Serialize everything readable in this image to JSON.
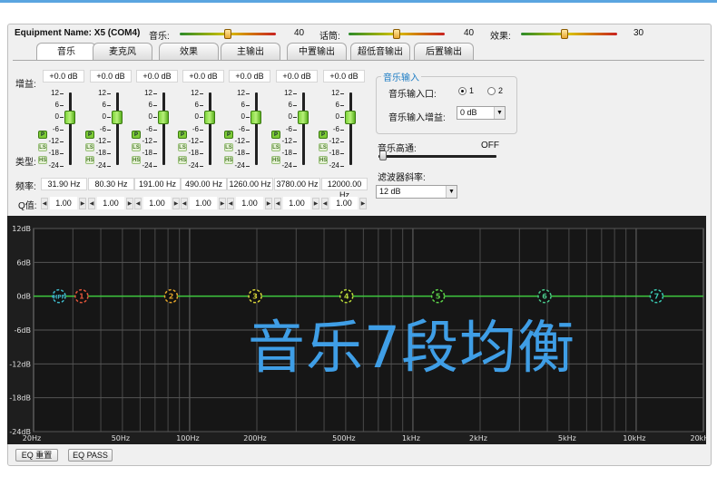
{
  "header": {
    "equipment_label": "Equipment Name: X5 (COM4)",
    "sliders": [
      {
        "label": "音乐:",
        "value": "40",
        "level": 0.5
      },
      {
        "label": "话筒:",
        "value": "40",
        "level": 0.5
      },
      {
        "label": "效果:",
        "value": "30",
        "level": 0.45
      }
    ]
  },
  "tabs": [
    "音乐",
    "麦克风",
    "效果",
    "主输出",
    "中置输出",
    "超低音输出",
    "后置输出"
  ],
  "active_tab": 0,
  "row_labels": {
    "gain": "增益:",
    "type": "类型:",
    "freq": "频率:",
    "q": "Q值:"
  },
  "scale_labels": [
    "12",
    "6",
    "0",
    "-6",
    "-12",
    "-18",
    "-24"
  ],
  "type_buttons": [
    "P",
    "LS",
    "HS"
  ],
  "bands": [
    {
      "gain": "+0.0 dB",
      "freq": "31.90 Hz",
      "q": "1.00",
      "gain_db": 0
    },
    {
      "gain": "+0.0 dB",
      "freq": "80.30 Hz",
      "q": "1.00",
      "gain_db": 0
    },
    {
      "gain": "+0.0 dB",
      "freq": "191.00 Hz",
      "q": "1.00",
      "gain_db": 0
    },
    {
      "gain": "+0.0 dB",
      "freq": "490.00 Hz",
      "q": "1.00",
      "gain_db": 0
    },
    {
      "gain": "+0.0 dB",
      "freq": "1260.00 Hz",
      "q": "1.00",
      "gain_db": 0
    },
    {
      "gain": "+0.0 dB",
      "freq": "3780.00 Hz",
      "q": "1.00",
      "gain_db": 0
    },
    {
      "gain": "+0.0 dB",
      "freq": "12000.00 Hz",
      "q": "1.00",
      "gain_db": 0
    }
  ],
  "music_input": {
    "title": "音乐输入",
    "port_label": "音乐输入口:",
    "port_options": [
      "1",
      "2"
    ],
    "port_selected": 0,
    "gain_label": "音乐输入增益:",
    "gain_value": "0 dB"
  },
  "highpass": {
    "label": "音乐高通:",
    "value": "OFF",
    "level": 0
  },
  "filter_slope": {
    "label": "滤波器斜率:",
    "value": "12 dB"
  },
  "graph": {
    "y_labels": [
      "12dB",
      "6dB",
      "0dB",
      "-6dB",
      "-12dB",
      "-18dB",
      "-24dB"
    ],
    "y_values": [
      12,
      6,
      0,
      -6,
      -12,
      -18,
      -24
    ],
    "x_labels": [
      "20Hz",
      "50Hz",
      "100Hz",
      "200Hz",
      "500Hz",
      "1kHz",
      "2kHz",
      "5kHz",
      "10kHz",
      "20kHz"
    ],
    "x_values": [
      20,
      50,
      100,
      200,
      500,
      1000,
      2000,
      5000,
      10000,
      20000
    ],
    "markers": [
      {
        "label": "HPF",
        "freq": 20,
        "color": "#3fb8c8"
      },
      {
        "label": "1",
        "freq": 31.9,
        "color": "#e0553a"
      },
      {
        "label": "2",
        "freq": 80.3,
        "color": "#e2a42a"
      },
      {
        "label": "3",
        "freq": 191,
        "color": "#d8d43a"
      },
      {
        "label": "4",
        "freq": 490,
        "color": "#b8d83a"
      },
      {
        "label": "5",
        "freq": 1260,
        "color": "#5ed24a"
      },
      {
        "label": "6",
        "freq": 3780,
        "color": "#4ac88a"
      },
      {
        "label": "7",
        "freq": 12000,
        "color": "#3ac8b0"
      }
    ],
    "curve_color": "#3ec83e",
    "overlay_text": "音乐7段均衡"
  },
  "buttons": {
    "eq_reset": "EQ 重置",
    "eq_pass": "EQ PASS"
  }
}
